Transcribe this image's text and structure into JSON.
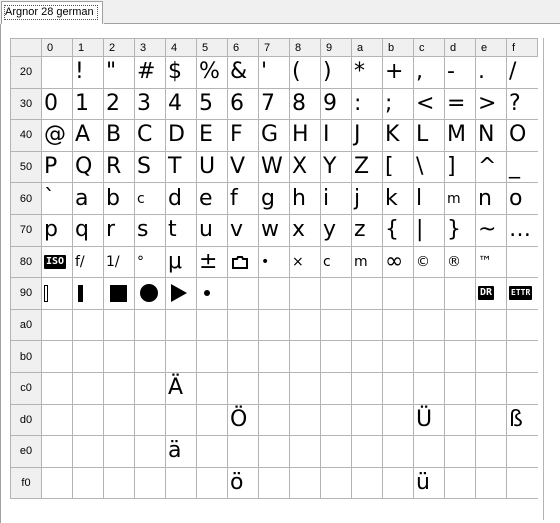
{
  "tab": {
    "label": "Argnor 28 german"
  },
  "columns": [
    "0",
    "1",
    "2",
    "3",
    "4",
    "5",
    "6",
    "7",
    "8",
    "9",
    "a",
    "b",
    "c",
    "d",
    "e",
    "f"
  ],
  "rows": [
    {
      "label": "20",
      "cells": [
        "",
        "!",
        "\"",
        "#",
        "$",
        "%",
        "&",
        "'",
        "(",
        ")",
        "*",
        "+",
        ",",
        "-",
        ".",
        "/"
      ]
    },
    {
      "label": "30",
      "cells": [
        "0",
        "1",
        "2",
        "3",
        "4",
        "5",
        "6",
        "7",
        "8",
        "9",
        ":",
        ";",
        "<",
        "=",
        ">",
        "?"
      ]
    },
    {
      "label": "40",
      "cells": [
        "@",
        "A",
        "B",
        "C",
        "D",
        "E",
        "F",
        "G",
        "H",
        "I",
        "J",
        "K",
        "L",
        "M",
        "N",
        "O"
      ]
    },
    {
      "label": "50",
      "cells": [
        "P",
        "Q",
        "R",
        "S",
        "T",
        "U",
        "V",
        "W",
        "X",
        "Y",
        "Z",
        "[",
        "\\",
        "]",
        "^",
        "_"
      ]
    },
    {
      "label": "60",
      "cells": [
        "`",
        "a",
        "b",
        "c",
        "d",
        "e",
        "f",
        "g",
        "h",
        "i",
        "j",
        "k",
        "l",
        "m",
        "n",
        "o"
      ]
    },
    {
      "label": "70",
      "cells": [
        "p",
        "q",
        "r",
        "s",
        "t",
        "u",
        "v",
        "w",
        "x",
        "y",
        "z",
        "{",
        "|",
        "}",
        "~",
        "…"
      ]
    },
    {
      "label": "80",
      "cells": [
        "ISO",
        "f/",
        "1/",
        "°",
        "μ",
        "±",
        "camera",
        "•",
        "×",
        "c",
        "m",
        "∞",
        "©",
        "®",
        "™",
        ""
      ]
    },
    {
      "label": "90",
      "cells": [
        "bar-outline",
        "bar-filled",
        "square-filled",
        "circle-filled",
        "triangle-right",
        "dot-small",
        "",
        "",
        "",
        "",
        "",
        "",
        "",
        "",
        "DR",
        "ETTR"
      ]
    },
    {
      "label": "a0",
      "cells": [
        "",
        "",
        "",
        "",
        "",
        "",
        "",
        "",
        "",
        "",
        "",
        "",
        "",
        "",
        "",
        ""
      ]
    },
    {
      "label": "b0",
      "cells": [
        "",
        "",
        "",
        "",
        "",
        "",
        "",
        "",
        "",
        "",
        "",
        "",
        "",
        "",
        "",
        ""
      ]
    },
    {
      "label": "c0",
      "cells": [
        "",
        "",
        "",
        "",
        "Ä",
        "",
        "",
        "",
        "",
        "",
        "",
        "",
        "",
        "",
        "",
        ""
      ]
    },
    {
      "label": "d0",
      "cells": [
        "",
        "",
        "",
        "",
        "",
        "",
        "Ö",
        "",
        "",
        "",
        "",
        "",
        "Ü",
        "",
        "",
        "ß"
      ]
    },
    {
      "label": "e0",
      "cells": [
        "",
        "",
        "",
        "",
        "ä",
        "",
        "",
        "",
        "",
        "",
        "",
        "",
        "",
        "",
        "",
        ""
      ]
    },
    {
      "label": "f0",
      "cells": [
        "",
        "",
        "",
        "",
        "",
        "",
        "ö",
        "",
        "",
        "",
        "",
        "",
        "ü",
        "",
        "",
        ""
      ]
    }
  ]
}
